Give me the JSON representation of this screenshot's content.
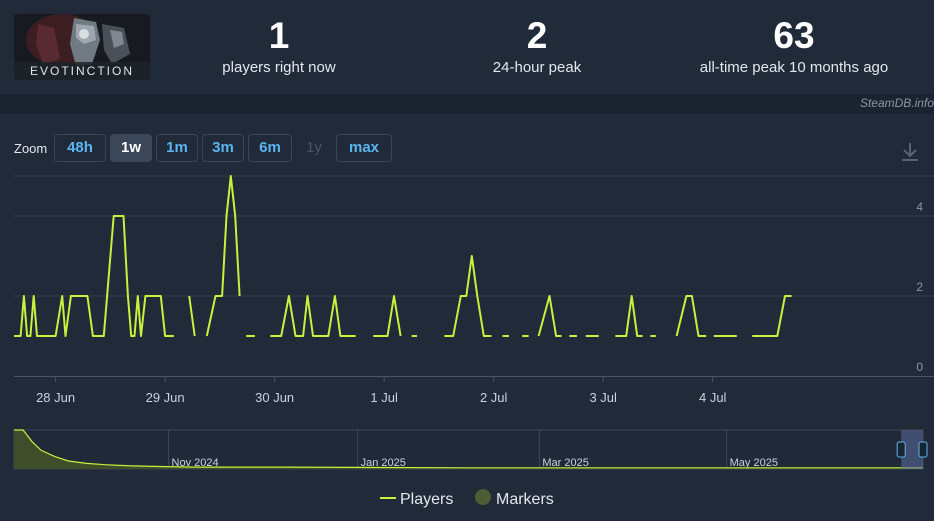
{
  "game": {
    "logo_text": "EVOTINCTION"
  },
  "stats": [
    {
      "value": "1",
      "label": "players right now"
    },
    {
      "value": "2",
      "label": "24-hour peak"
    },
    {
      "value": "63",
      "label": "all-time peak 10 months ago"
    }
  ],
  "credit": "SteamDB.info",
  "zoom": {
    "label": "Zoom",
    "buttons": [
      {
        "label": "48h",
        "state": "normal"
      },
      {
        "label": "1w",
        "state": "active"
      },
      {
        "label": "1m",
        "state": "normal"
      },
      {
        "label": "3m",
        "state": "normal"
      },
      {
        "label": "6m",
        "state": "normal"
      },
      {
        "label": "1y",
        "state": "disabled"
      },
      {
        "label": "max",
        "state": "normal"
      }
    ]
  },
  "download_icon": "download-icon",
  "colors": {
    "accent": "#c8f03c",
    "link": "#59b6f0",
    "panel": "#202a38",
    "background": "#1b2230"
  },
  "chart_data": {
    "type": "line",
    "x_unit": "days",
    "xlim": [
      0,
      8.3
    ],
    "ylim": [
      0,
      5
    ],
    "yticks": [
      0,
      2,
      4
    ],
    "xtick_labels": [
      "28 Jun",
      "29 Jun",
      "30 Jun",
      "1 Jul",
      "2 Jul",
      "3 Jul",
      "4 Jul"
    ],
    "xtick_positions": [
      0.38,
      1.38,
      2.38,
      3.38,
      4.38,
      5.38,
      6.38
    ],
    "grid": true,
    "series": [
      {
        "name": "Players",
        "color": "#c8f03c",
        "segments": [
          [
            [
              0,
              1
            ],
            [
              0.06,
              1
            ],
            [
              0.09,
              2
            ],
            [
              0.12,
              1
            ],
            [
              0.15,
              1
            ],
            [
              0.18,
              2
            ],
            [
              0.21,
              1
            ],
            [
              0.38,
              1
            ],
            [
              0.44,
              2
            ],
            [
              0.47,
              1
            ],
            [
              0.52,
              2
            ],
            [
              0.67,
              2
            ],
            [
              0.72,
              1
            ],
            [
              0.82,
              1
            ],
            [
              0.88,
              3
            ],
            [
              0.91,
              4
            ],
            [
              1.0,
              4
            ],
            [
              1.04,
              2
            ],
            [
              1.07,
              1
            ],
            [
              1.1,
              1
            ],
            [
              1.13,
              2
            ],
            [
              1.16,
              1
            ],
            [
              1.2,
              2
            ],
            [
              1.34,
              2
            ],
            [
              1.38,
              1
            ],
            [
              1.46,
              1
            ]
          ],
          [
            [
              1.6,
              2
            ],
            [
              1.65,
              1
            ]
          ],
          [
            [
              1.76,
              1
            ],
            [
              1.84,
              2
            ],
            [
              1.9,
              2
            ],
            [
              1.94,
              4
            ],
            [
              1.98,
              5
            ],
            [
              2.02,
              4
            ],
            [
              2.06,
              2
            ]
          ],
          [
            [
              2.12,
              1
            ],
            [
              2.2,
              1
            ]
          ],
          [
            [
              2.34,
              1
            ],
            [
              2.44,
              1
            ],
            [
              2.51,
              2
            ],
            [
              2.57,
              1
            ],
            [
              2.64,
              1
            ],
            [
              2.68,
              2
            ],
            [
              2.73,
              1
            ],
            [
              2.87,
              1
            ],
            [
              2.93,
              2
            ],
            [
              2.98,
              1
            ],
            [
              3.12,
              1
            ]
          ],
          [
            [
              3.28,
              1
            ],
            [
              3.41,
              1
            ],
            [
              3.47,
              2
            ],
            [
              3.53,
              1
            ]
          ],
          [
            [
              3.63,
              1
            ],
            [
              3.68,
              1
            ]
          ],
          [
            [
              3.93,
              1
            ],
            [
              4.01,
              1
            ],
            [
              4.08,
              2
            ],
            [
              4.13,
              2
            ],
            [
              4.18,
              3
            ],
            [
              4.23,
              2
            ],
            [
              4.29,
              1
            ],
            [
              4.36,
              1
            ]
          ],
          [
            [
              4.46,
              1
            ],
            [
              4.52,
              1
            ]
          ],
          [
            [
              4.64,
              1
            ],
            [
              4.7,
              1
            ]
          ],
          [
            [
              4.79,
              1
            ],
            [
              4.89,
              2
            ],
            [
              4.95,
              1
            ],
            [
              5.0,
              1
            ]
          ],
          [
            [
              5.07,
              1
            ],
            [
              5.14,
              1
            ]
          ],
          [
            [
              5.22,
              1
            ],
            [
              5.34,
              1
            ]
          ],
          [
            [
              5.49,
              1
            ],
            [
              5.59,
              1
            ],
            [
              5.64,
              2
            ],
            [
              5.69,
              1
            ],
            [
              5.74,
              1
            ]
          ],
          [
            [
              5.81,
              1
            ],
            [
              5.86,
              1
            ]
          ],
          [
            [
              6.05,
              1
            ],
            [
              6.14,
              2
            ],
            [
              6.19,
              2
            ],
            [
              6.25,
              1
            ],
            [
              6.32,
              1
            ]
          ],
          [
            [
              6.39,
              1
            ],
            [
              6.6,
              1
            ]
          ],
          [
            [
              6.74,
              1
            ],
            [
              6.97,
              1
            ],
            [
              7.04,
              2
            ],
            [
              7.1,
              2
            ]
          ]
        ]
      }
    ],
    "legend": [
      {
        "label": "Players",
        "type": "line",
        "color": "#c8f03c"
      },
      {
        "label": "Markers",
        "type": "circle",
        "color": "#4e5d35"
      }
    ],
    "legend_position": "bottom",
    "navigator": {
      "labels": [
        "Nov 2024",
        "Jan 2025",
        "Mar 2025",
        "May 2025"
      ],
      "label_fractions": [
        0.17,
        0.378,
        0.578,
        0.784
      ],
      "xlim": [
        0,
        1
      ],
      "ylim": [
        0,
        63
      ],
      "profile": [
        [
          0,
          63
        ],
        [
          0.01,
          63
        ],
        [
          0.02,
          44
        ],
        [
          0.03,
          30
        ],
        [
          0.045,
          20
        ],
        [
          0.06,
          13
        ],
        [
          0.08,
          9
        ],
        [
          0.1,
          7
        ],
        [
          0.13,
          5
        ],
        [
          0.16,
          4
        ],
        [
          0.2,
          3
        ],
        [
          0.3,
          3
        ],
        [
          0.5,
          2
        ],
        [
          0.7,
          2
        ],
        [
          0.9,
          2
        ],
        [
          1,
          2
        ]
      ],
      "selection_fraction": [
        0.976,
        1
      ]
    }
  }
}
